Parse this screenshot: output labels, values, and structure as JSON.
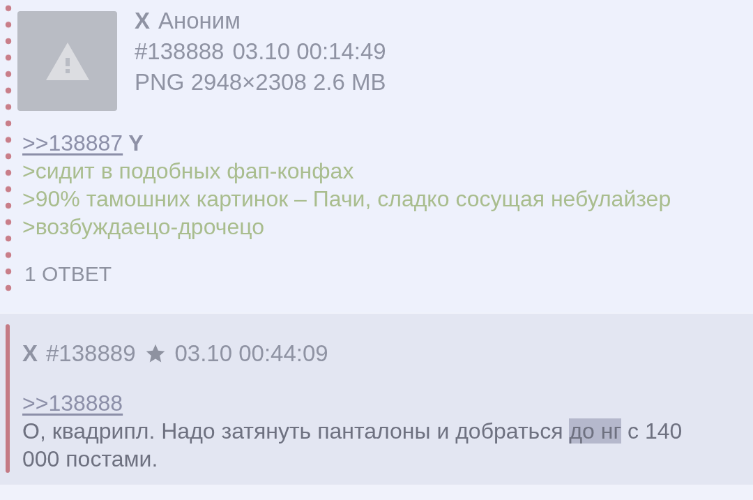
{
  "posts": [
    {
      "kind": "dotted",
      "mark": "X",
      "name": "Аноним",
      "number": "#138888",
      "date": "03.10 00:14:49",
      "file_info": "PNG 2948×2308 2.6 MB",
      "thumbnail": {
        "kind": "broken"
      },
      "lines": [
        {
          "kind": "link",
          "text": ">>138887",
          "suffix": "Y"
        },
        {
          "kind": "quote",
          "text": ">сидит в подобных фап-конфах"
        },
        {
          "kind": "quote",
          "text": ">90% тамошних картинок – Пачи, сладко сосущая небулайзер"
        },
        {
          "kind": "quote",
          "text": ">возбуждаецо-дрочецо"
        }
      ],
      "replies": "1 ОТВЕТ"
    },
    {
      "kind": "solid",
      "mark": "X",
      "number": "#138889",
      "date": "03.10 00:44:09",
      "starred": true,
      "lines": [
        {
          "kind": "link",
          "text": ">>138888"
        },
        {
          "kind": "text",
          "segments": [
            {
              "text": "О, квадрипл. Надо затянуть панталоны и добраться ",
              "selected": false
            },
            {
              "text": "до нг",
              "selected": true
            },
            {
              "text": " с 140 000 постами.",
              "selected": false
            }
          ]
        }
      ]
    }
  ]
}
